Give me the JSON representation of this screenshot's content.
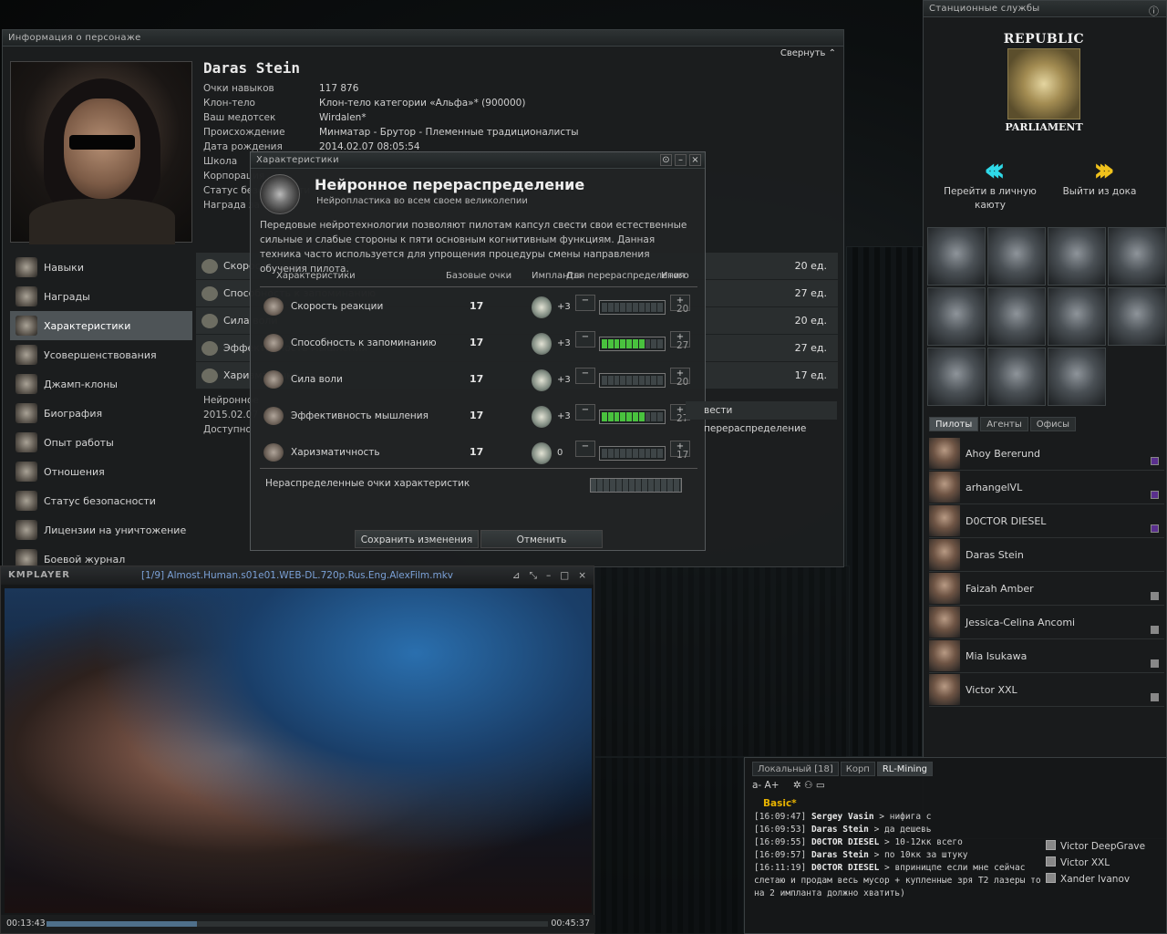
{
  "char": {
    "title": "Информация о персонаже",
    "collapse": "Свернуть",
    "name": "Daras Stein",
    "info": [
      {
        "k": "Очки навыков",
        "v": "117 876"
      },
      {
        "k": "Клон-тело",
        "v": "Клон-тело категории «Альфа»* (900000)"
      },
      {
        "k": "Ваш медотсек",
        "v": "Wirdalen*"
      },
      {
        "k": "Происхождение",
        "v": "Минматар - Брутор - Племенные традиционалисты"
      },
      {
        "k": "Дата рождения",
        "v": "2014.02.07 08:05:54"
      },
      {
        "k": "Школа",
        "v": ""
      },
      {
        "k": "Корпорация",
        "v": ""
      },
      {
        "k": "Статус безопасности",
        "v": ""
      },
      {
        "k": "Награда за голову",
        "v": ""
      }
    ],
    "nav": [
      "Навыки",
      "Награды",
      "Характеристики",
      "Усовершенствования",
      "Джамп-клоны",
      "Биография",
      "Опыт работы",
      "Отношения",
      "Статус безопасности",
      "Лицензии на уничтожение",
      "Боевой журнал"
    ],
    "attr_rows": [
      {
        "n": "Скорость реакции",
        "u": "20 ед."
      },
      {
        "n": "Способность к запоминанию",
        "u": "27 ед."
      },
      {
        "n": "Сила воли",
        "u": "20 ед."
      },
      {
        "n": "Эффективность мышления",
        "u": "27 ед."
      },
      {
        "n": "Харизматичность",
        "u": "17 ед."
      }
    ],
    "neuro_label": "Нейронное",
    "neuro_date": "2015.02.07",
    "neuro_avail": "Доступно",
    "perform_button": "вести перераспределение"
  },
  "neural": {
    "window_title": "Характеристики",
    "title": "Нейронное перераспределение",
    "subtitle": "Нейропластика во всем своем великолепии",
    "desc": "Передовые нейротехнологии позволяют пилотам капсул свести свои естественные сильные и слабые стороны к пяти основным когнитивным функциям. Данная техника часто используется для упрощения процедуры смены направления обучения пилота.",
    "col_attr": "Характеристики",
    "col_base": "Базовые очки",
    "col_impl": "Импланты",
    "col_realloc": "Для перераспределения",
    "col_total": "Итого",
    "rows": [
      {
        "n": "Скорость реакции",
        "base": "17",
        "impl": "+3",
        "filled": 0,
        "total": "20"
      },
      {
        "n": "Способность к запоминанию",
        "base": "17",
        "impl": "+3",
        "filled": 7,
        "total": "27"
      },
      {
        "n": "Сила воли",
        "base": "17",
        "impl": "+3",
        "filled": 0,
        "total": "20"
      },
      {
        "n": "Эффективность мышления",
        "base": "17",
        "impl": "+3",
        "filled": 7,
        "total": "27"
      },
      {
        "n": "Харизматичность",
        "base": "17",
        "impl": "0",
        "filled": 0,
        "total": "17"
      }
    ],
    "minus": "−",
    "plus": "+",
    "unallocated": "Нераспределенные очки характеристик",
    "save": "Сохранить изменения",
    "cancel": "Отменить"
  },
  "station": {
    "title": "Станционные службы",
    "logo_top": "REPUBLIC",
    "logo_bottom": "PARLIAMENT",
    "enter_quarters": "Перейти в личную каюту",
    "undock": "Выйти из дока",
    "tabs": [
      "Пилоты",
      "Агенты",
      "Офисы"
    ],
    "pilots": [
      {
        "name": "Ahoy Bererund",
        "st": "p"
      },
      {
        "name": "arhangelVL",
        "st": "p"
      },
      {
        "name": "D0CTOR DIESEL",
        "st": "p"
      },
      {
        "name": "Daras Stein",
        "st": ""
      },
      {
        "name": "Faizah Amber",
        "st": "g"
      },
      {
        "name": "Jessica-Celina Ancomi",
        "st": "g"
      },
      {
        "name": "Mia Isukawa",
        "st": "g"
      },
      {
        "name": "Victor XXL",
        "st": "g"
      }
    ]
  },
  "chat": {
    "tabs": [
      "Локальный [18]",
      "Корп",
      "RL-Mining"
    ],
    "tools": "a- A+",
    "channel": "Basic*",
    "messages": [
      {
        "t": "[16:09:47]",
        "who": "Sergey Vasin",
        "msg": " > нифига с"
      },
      {
        "t": "[16:09:53]",
        "who": "Daras Stein",
        "msg": " > да дешевь"
      },
      {
        "t": "[16:09:55]",
        "who": "D0CTOR DIESEL",
        "msg": " > 10-12кк всего"
      },
      {
        "t": "[16:09:57]",
        "who": "Daras Stein",
        "msg": " > по 10кк за штуку"
      },
      {
        "t": "[16:11:19]",
        "who": "D0CTOR DIESEL",
        "msg": " > вприницпе если мне сейчас слетаю и продам весь мусор + купленные зря T2 лазеры то на 2 импланта должно хватить)"
      }
    ],
    "members": [
      "Victor DeepGrave",
      "Victor XXL",
      "Xander Ivanov"
    ]
  },
  "player": {
    "brand": "KMPLAYER",
    "title": "[1/9] Almost.Human.s01e01.WEB-DL.720p.Rus.Eng.AlexFilm.mkv",
    "time_elapsed": "00:13:43",
    "time_total": "00:45:37",
    "progress": 0.3
  }
}
